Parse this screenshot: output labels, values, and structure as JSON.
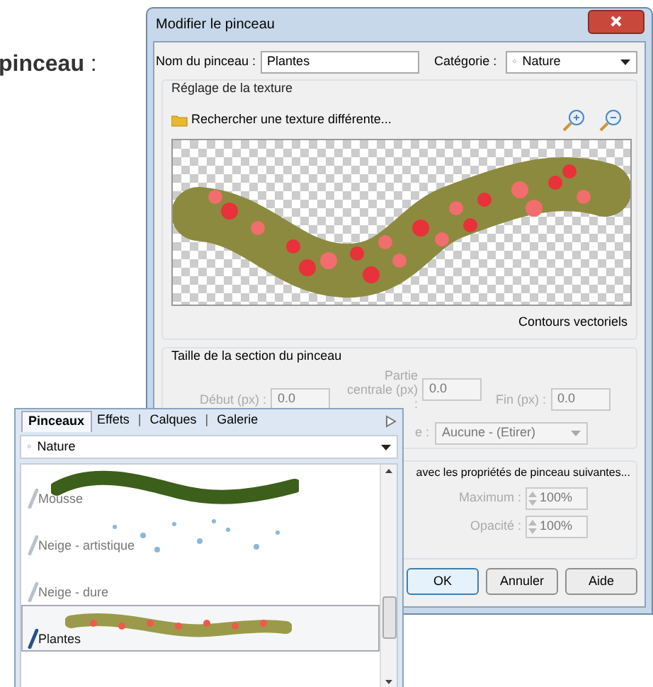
{
  "heading": "**pinceau** :",
  "dialog": {
    "title": "Modifier le pinceau",
    "name_label": "Nom du pinceau :",
    "name_value": "Plantes",
    "category_label": "Catégorie :",
    "category_bullet": "◦",
    "category_value": "Nature",
    "texture": {
      "title": "Réglage de la texture",
      "browse": "Rechercher une texture différente...",
      "vector": "Contours vectoriels"
    },
    "section": {
      "title": "Taille de la section du pinceau",
      "fields": [
        {
          "label": "Début (px) :",
          "value": "0.0",
          "disabled": true
        },
        {
          "label": "Partie centrale (px) :",
          "value": "0.0",
          "disabled": true
        },
        {
          "label": "Fin (px) :",
          "value": "0.0",
          "disabled": true
        }
      ],
      "mode_label": "e :",
      "mode_value": "Aucune - (Etirer)",
      "mode_disabled": true
    },
    "props": {
      "title": "avec les propriétés de pinceau suivantes...",
      "spins": [
        {
          "label": "Maximum :",
          "value": "100%",
          "disabled": true
        },
        {
          "label": "Opacité :",
          "value": "100%",
          "disabled": true
        }
      ]
    },
    "buttons": [
      {
        "label": "OK",
        "selected": true
      },
      {
        "label": "Annuler",
        "selected": false
      },
      {
        "label": "Aide",
        "selected": false
      }
    ]
  },
  "panel": {
    "tabs": [
      {
        "label": "Pinceaux",
        "selected": true
      },
      {
        "label": "Effets",
        "selected": false
      },
      {
        "label": "Calques",
        "selected": false
      },
      {
        "label": "Galerie",
        "selected": false
      }
    ],
    "tab_separator": "|",
    "category_bullet": "◦",
    "category": "Nature",
    "items": [
      {
        "name": "Mousse",
        "kind": "moss",
        "selected": false
      },
      {
        "name": "Neige - artistique",
        "kind": "snow",
        "selected": false
      },
      {
        "name": "Neige - dure",
        "kind": "plain",
        "selected": false
      },
      {
        "name": "Plantes",
        "kind": "plants",
        "selected": true
      }
    ]
  }
}
